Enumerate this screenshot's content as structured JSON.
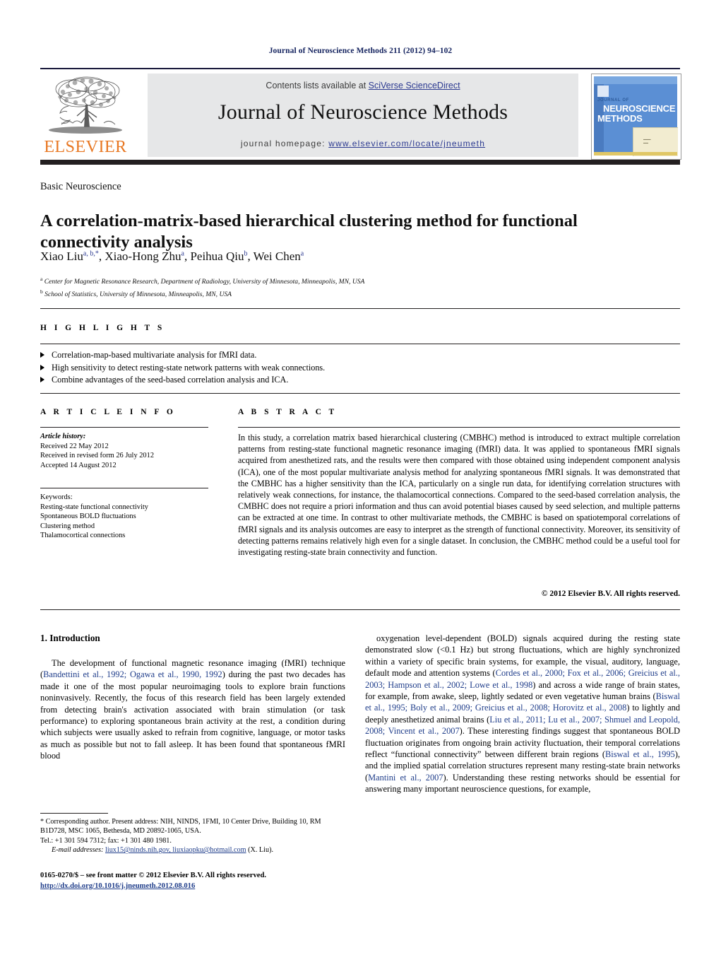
{
  "running_head": "Journal of Neuroscience Methods 211 (2012) 94–102",
  "masthead": {
    "contents_prefix": "Contents lists available at ",
    "contents_link": "SciVerse ScienceDirect",
    "journal_title": "Journal of Neuroscience Methods",
    "homepage_prefix": "journal homepage: ",
    "homepage_url": "www.elsevier.com/locate/jneumeth",
    "publisher_logo_text": "ELSEVIER",
    "cover": {
      "journal_of": "JOURNAL OF",
      "line1": "NEUROSCIENCE",
      "line2": "METHODS"
    }
  },
  "article": {
    "category": "Basic Neuroscience",
    "title": "A correlation-matrix-based hierarchical clustering method for functional connectivity analysis",
    "authors_html": "Xiao Liu<sup>a, b,</sup><sup>*</sup>, Xiao-Hong Zhu<sup>a</sup>, Peihua Qiu<sup>b</sup>, Wei Chen<sup>a</sup>",
    "affiliations": [
      {
        "marker": "a",
        "text": "Center for Magnetic Resonance Research, Department of Radiology, University of Minnesota, Minneapolis, MN, USA"
      },
      {
        "marker": "b",
        "text": "School of Statistics, University of Minnesota, Minneapolis, MN, USA"
      }
    ]
  },
  "highlights": {
    "label": "H I G H L I G H T S",
    "items": [
      "Correlation-map-based multivariate analysis for fMRI data.",
      "High sensitivity to detect resting-state network patterns with weak connections.",
      "Combine advantages of the seed-based correlation analysis and ICA."
    ]
  },
  "article_info": {
    "label": "A R T I C L E   I N F O",
    "history_label": "Article history:",
    "history": [
      "Received 22 May 2012",
      "Received in revised form 26 July 2012",
      "Accepted 14 August 2012"
    ],
    "keywords_label": "Keywords:",
    "keywords": [
      "Resting-state functional connectivity",
      "Spontaneous BOLD fluctuations",
      "Clustering method",
      "Thalamocortical connections"
    ]
  },
  "abstract": {
    "label": "A B S T R A C T",
    "text": "In this study, a correlation matrix based hierarchical clustering (CMBHC) method is introduced to extract multiple correlation patterns from resting-state functional magnetic resonance imaging (fMRI) data. It was applied to spontaneous fMRI signals acquired from anesthetized rats, and the results were then compared with those obtained using independent component analysis (ICA), one of the most popular multivariate analysis method for analyzing spontaneous fMRI signals. It was demonstrated that the CMBHC has a higher sensitivity than the ICA, particularly on a single run data, for identifying correlation structures with relatively weak connections, for instance, the thalamocortical connections. Compared to the seed-based correlation analysis, the CMBHC does not require a priori information and thus can avoid potential biases caused by seed selection, and multiple patterns can be extracted at one time. In contrast to other multivariate methods, the CMBHC is based on spatiotemporal correlations of fMRI signals and its analysis outcomes are easy to interpret as the strength of functional connectivity. Moreover, its sensitivity of detecting patterns remains relatively high even for a single dataset. In conclusion, the CMBHC method could be a useful tool for investigating resting-state brain connectivity and function.",
    "copyright": "© 2012 Elsevier B.V. All rights reserved."
  },
  "introduction": {
    "heading": "1.  Introduction",
    "left_html": "The development of functional magnetic resonance imaging (fMRI) technique (<span class=\"ref\">Bandettini et al., 1992; Ogawa et al., 1990, 1992</span>) during the past two decades has made it one of the most popular neuroimaging tools to explore brain functions noninvasively. Recently, the focus of this research field has been largely extended from detecting brain's activation associated with brain stimulation (or task performance) to exploring spontaneous brain activity at the rest, a condition during which subjects were usually asked to refrain from cognitive, language, or motor tasks as much as possible but not to fall asleep. It has been found that spontaneous fMRI blood",
    "right_html": "oxygenation level-dependent (BOLD) signals acquired during the resting state demonstrated slow (&lt;0.1 Hz) but strong fluctuations, which are highly synchronized within a variety of specific brain systems, for example, the visual, auditory, language, default mode and attention systems (<span class=\"ref\">Cordes et al., 2000; Fox et al., 2006; Greicius et al., 2003; Hampson et al., 2002; Lowe et al., 1998</span>) and across a wide range of brain states, for example, from awake, sleep, lightly sedated or even vegetative human brains (<span class=\"ref\">Biswal et al., 1995; Boly et al., 2009; Greicius et al., 2008; Horovitz et al., 2008</span>) to lightly and deeply anesthetized animal brains (<span class=\"ref\">Liu et al., 2011; Lu et al., 2007; Shmuel and Leopold, 2008; Vincent et al., 2007</span>). These interesting findings suggest that spontaneous BOLD fluctuation originates from ongoing brain activity fluctuation, their temporal correlations reflect “functional connectivity” between different brain regions (<span class=\"ref\">Biswal et al., 1995</span>), and the implied spatial correlation structures represent many resting-state brain networks (<span class=\"ref\">Mantini et al., 2007</span>). Understanding these resting networks should be essential for answering many important neuroscience questions, for example,"
  },
  "footnote": {
    "line1": "* Corresponding author. Present address: NIH, NINDS, 1FMI, 10 Center Drive, Building 10, RM B1D728, MSC 1065, Bethesda, MD 20892-1065, USA.",
    "line2": "Tel.: +1 301 594 7312; fax: +1 301 480 1981.",
    "email_label": "E-mail addresses:",
    "emails": "liux15@ninds.nih.gov, liuxiaopku@hotmail.com",
    "email_suffix": " (X. Liu)."
  },
  "footer": {
    "issn": "0165-0270/$ – see front matter © 2012 Elsevier B.V. All rights reserved.",
    "doi": "http://dx.doi.org/10.1016/j.jneumeth.2012.08.016"
  }
}
